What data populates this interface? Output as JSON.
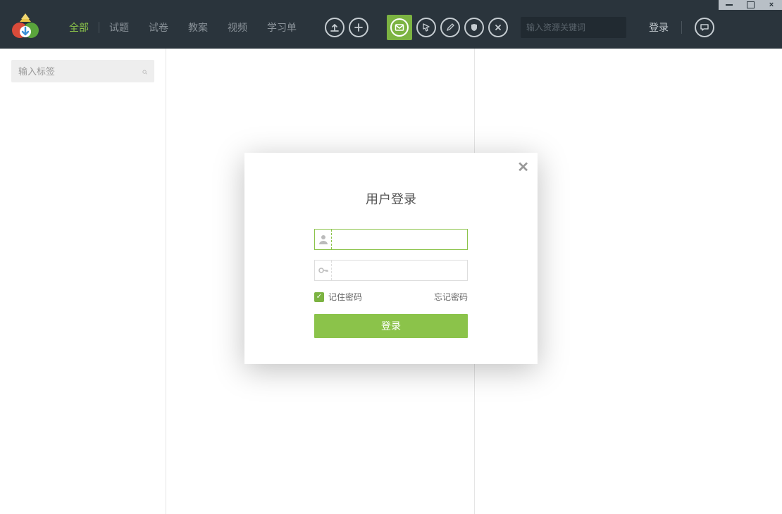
{
  "window": {
    "close_glyph": "×"
  },
  "nav": {
    "tabs": [
      {
        "label": "全部",
        "active": true
      },
      {
        "label": "试题",
        "active": false
      },
      {
        "label": "试卷",
        "active": false
      },
      {
        "label": "教案",
        "active": false
      },
      {
        "label": "视频",
        "active": false
      },
      {
        "label": "学习单",
        "active": false
      }
    ]
  },
  "header": {
    "search_placeholder": "输入资源关键词",
    "login_label": "登录"
  },
  "sidebar": {
    "tag_search_placeholder": "输入标签"
  },
  "modal": {
    "title": "用户登录",
    "remember_label": "记住密码",
    "forgot_label": "忘记密码",
    "login_button_label": "登录",
    "close_glyph": "✕",
    "checkbox_glyph": "✓"
  }
}
